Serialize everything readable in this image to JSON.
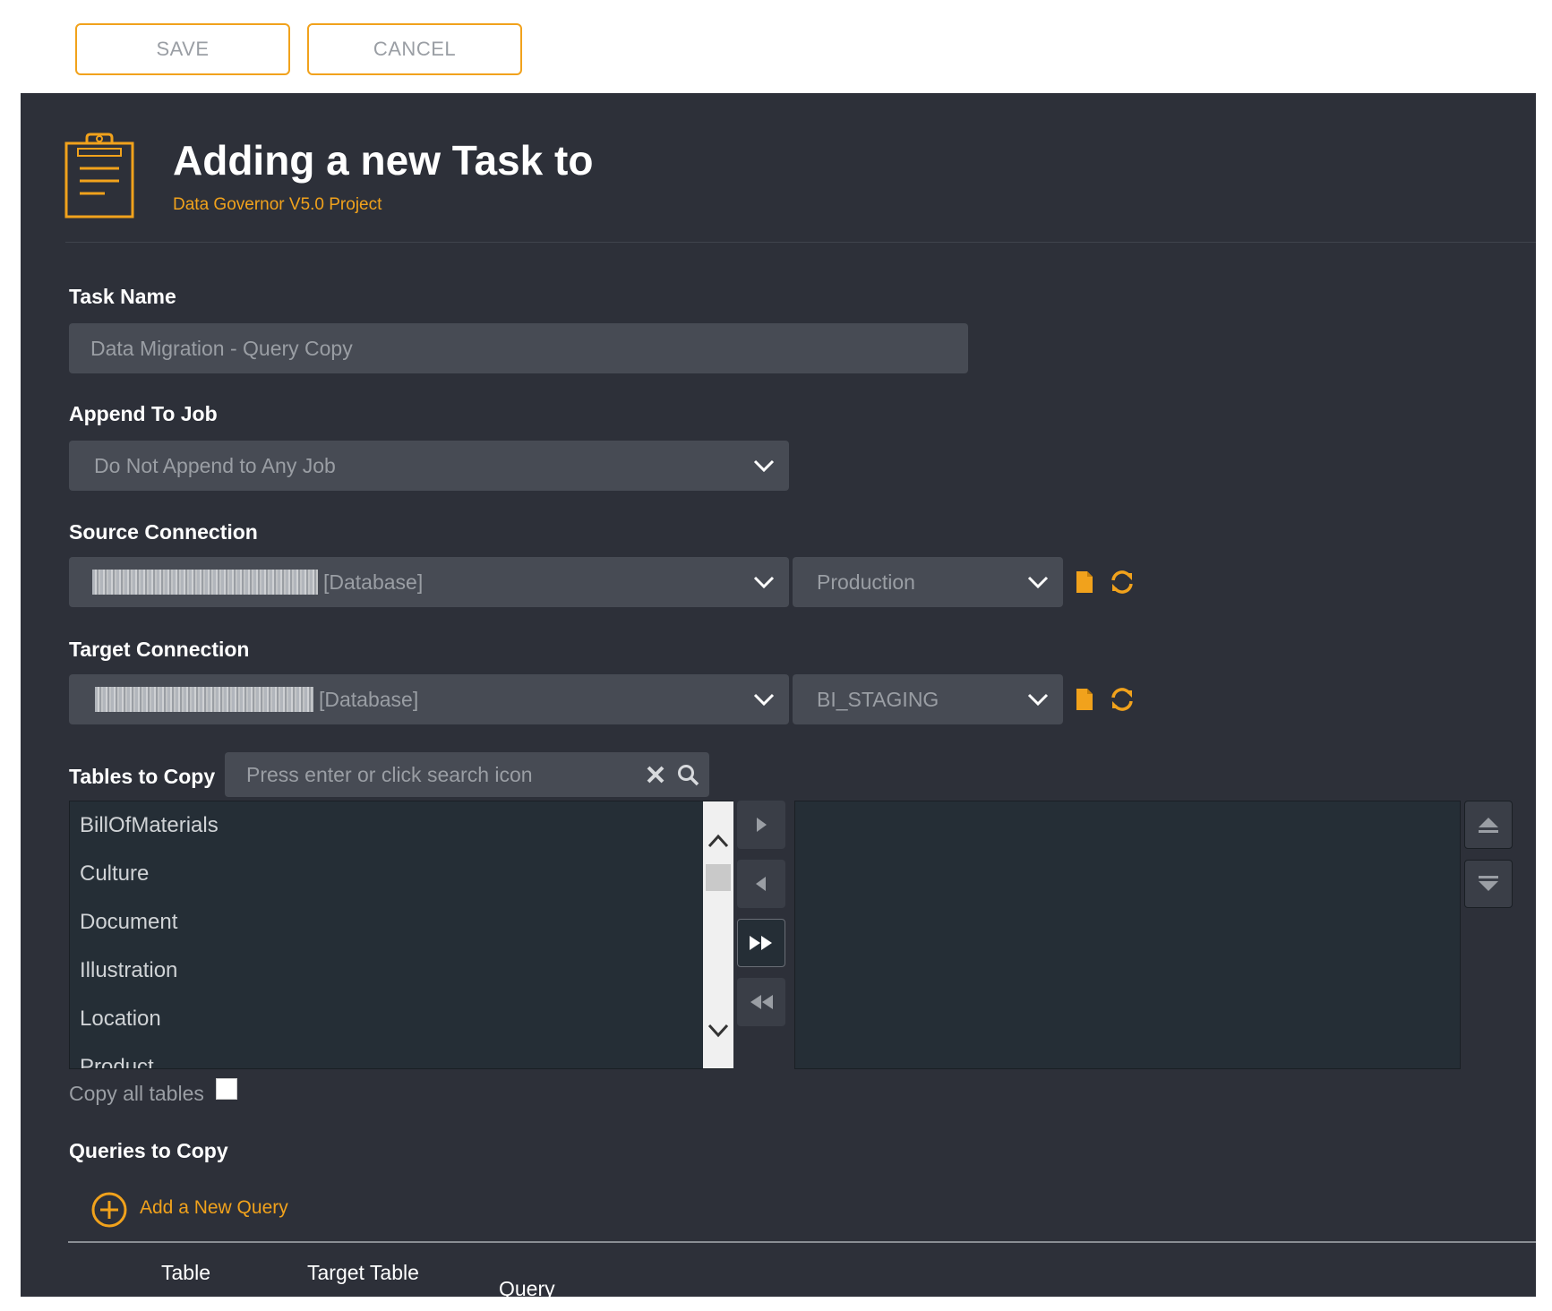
{
  "toolbar": {
    "save_label": "SAVE",
    "cancel_label": "CANCEL"
  },
  "header": {
    "title": "Adding a new Task to",
    "subtitle": "Data Governor V5.0 Project",
    "icon": "clipboard-icon"
  },
  "colors": {
    "accent": "#f1a21c",
    "panel_bg": "#2d3039",
    "field_bg": "#474b54",
    "list_bg": "#252e36"
  },
  "task_name": {
    "label": "Task Name",
    "value": "Data Migration - Query Copy"
  },
  "append_job": {
    "label": "Append To Job",
    "value": "Do Not Append to Any Job"
  },
  "source": {
    "label": "Source Connection",
    "connection_suffix": "[Database]",
    "database": "Production"
  },
  "target": {
    "label": "Target Connection",
    "connection_suffix": "[Database]",
    "database": "BI_STAGING"
  },
  "tables": {
    "label": "Tables to Copy",
    "search_placeholder": "Press enter or click search icon",
    "available": [
      "BillOfMaterials",
      "Culture",
      "Document",
      "Illustration",
      "Location",
      "Product"
    ],
    "copy_all_label": "Copy all tables",
    "copy_all_checked": false
  },
  "queries": {
    "label": "Queries to Copy",
    "add_label": "Add a New Query",
    "columns": [
      "Table",
      "Target Table",
      "Query"
    ]
  }
}
